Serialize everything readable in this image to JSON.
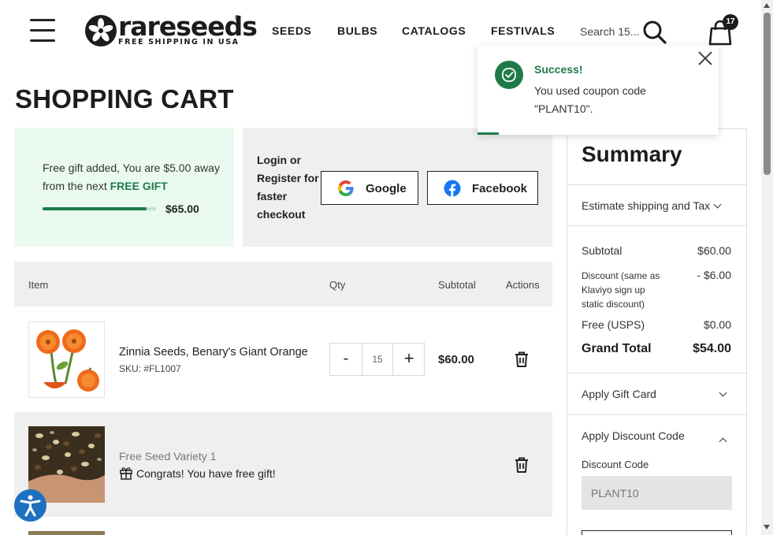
{
  "header": {
    "brand": "rareseeds",
    "tagline": "FREE SHIPPING IN USA",
    "nav": [
      "SEEDS",
      "BULBS",
      "CATALOGS",
      "FESTIVALS"
    ],
    "search_placeholder": "Search 15...",
    "cart_count": "17",
    "icons": [
      "menu-icon",
      "search-icon",
      "shopping-bag-icon"
    ]
  },
  "page": {
    "title": "SHOPPING CART"
  },
  "free_gift": {
    "text_before": "Free gift added, You are $5.00 away from the next ",
    "highlight": "FREE GIFT",
    "progress_fraction": 0.92,
    "amount": "$65.00",
    "accent_color": "#1f7a4a"
  },
  "login": {
    "text": "Login or Register for faster checkout",
    "google_label": "Google",
    "facebook_label": "Facebook"
  },
  "cart_table": {
    "columns": [
      "Item",
      "Qty",
      "Subtotal",
      "Actions"
    ],
    "rows": [
      {
        "name": "Zinnia Seeds, Benary's Giant Orange",
        "sku": "SKU: #FL1007",
        "qty": "15",
        "subtotal": "$60.00"
      },
      {
        "name": "Free Seed Variety 1",
        "note": "Congrats! You have free gift!"
      }
    ]
  },
  "summary": {
    "title": "Summary",
    "estimate": "Estimate shipping and Tax",
    "subtotal_label": "Subtotal",
    "subtotal_value": "$60.00",
    "discount_label": "Discount (same as Klaviyo sign up static discount)",
    "discount_value": "- $6.00",
    "shipping_label": "Free (USPS)",
    "shipping_value": "$0.00",
    "grand_total_label": "Grand Total",
    "grand_total_value": "$54.00",
    "gift_card_label": "Apply Gift Card",
    "discount_code_section": "Apply Discount Code",
    "discount_code_field_label": "Discount Code",
    "discount_code_value": "PLANT10"
  },
  "toast": {
    "title": "Success!",
    "message": "You used coupon code \"PLANT10\"."
  }
}
